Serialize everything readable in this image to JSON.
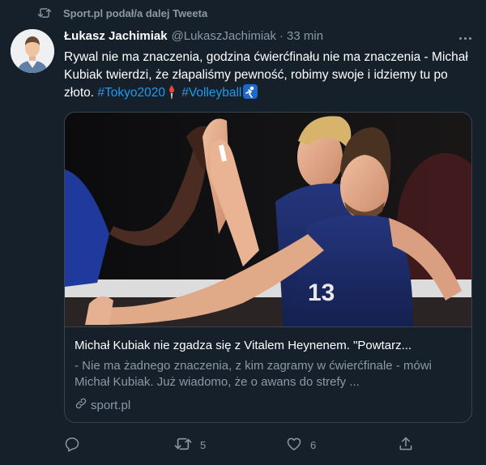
{
  "retweet": {
    "icon": "retweet-icon",
    "text": "Sport.pl podał/a dalej Tweeta"
  },
  "author": {
    "name": "Łukasz Jachimiak",
    "handle": "@LukaszJachimiak",
    "separator": "·",
    "time": "33 min"
  },
  "tweet": {
    "text_part1": "Rywal nie ma znaczenia, godzina ćwierćfinału nie ma znaczenia - Michał Kubiak twierdzi, że złapaliśmy pewność, robimy swoje i idziemy tu po złoto. ",
    "hashtag1": "#Tokyo2020",
    "hashtag2": "#Volleyball"
  },
  "card": {
    "jersey_number": "13",
    "title": "Michał Kubiak nie zgadza się z Vitalem Heynenem. \"Powtarz...",
    "description": "- Nie ma żadnego znaczenia, z kim zagramy w ćwierćfinale - mówi Michał Kubiak. Już wiadomo, że o awans do strefy ...",
    "domain": "sport.pl"
  },
  "actions": {
    "reply": {
      "icon": "reply-icon",
      "count": ""
    },
    "retweet": {
      "icon": "retweet-icon",
      "count": "5"
    },
    "like": {
      "icon": "heart-icon",
      "count": "6"
    },
    "share": {
      "icon": "share-icon",
      "count": ""
    }
  },
  "colors": {
    "background": "#15202b",
    "border": "#38444d",
    "muted": "#8b98a5",
    "hashtag": "#1d9bf0",
    "jersey": "#1b2a6b"
  }
}
